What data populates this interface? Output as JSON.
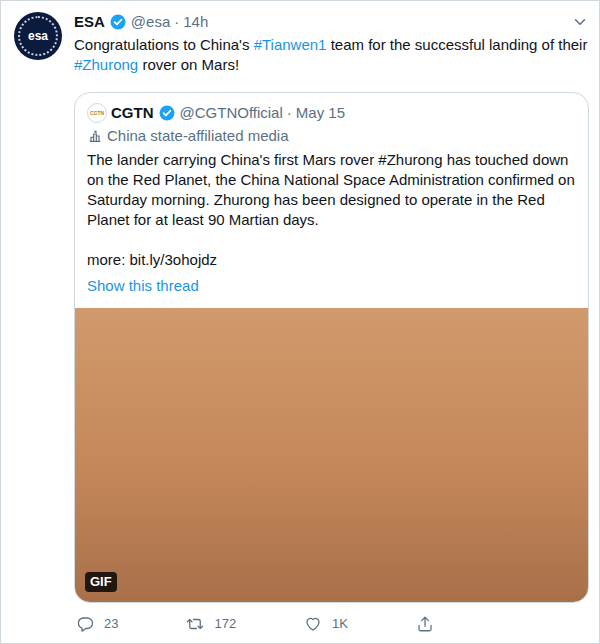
{
  "tweet": {
    "author_name": "ESA",
    "logo_text": "esa",
    "verified": true,
    "handle": "@esa",
    "separator": "·",
    "time": "14h",
    "text": [
      {
        "text": "Congratulations to China's ",
        "kind": "plain"
      },
      {
        "text": "#Tianwen1",
        "kind": "hashtag"
      },
      {
        "text": " team for the successful landing of their ",
        "kind": "plain"
      },
      {
        "text": "#Zhurong",
        "kind": "hashtag"
      },
      {
        "text": " rover on Mars!",
        "kind": "plain"
      }
    ]
  },
  "quoted": {
    "author_name": "CGTN",
    "logo_text": "CGTN",
    "verified": true,
    "handle": "@CGTNOfficial",
    "separator": "·",
    "time": "May 15",
    "label": "China state-affiliated media",
    "text": "The lander carrying China's first Mars rover #Zhurong has touched down on the Red Planet, the China National Space Administration confirmed on Saturday morning. Zhurong has been designed to operate in the Red Planet for at least 90 Martian days.",
    "link_line": "more: bit.ly/3ohojdz",
    "thread_link": "Show this thread",
    "media_badge": "GIF"
  },
  "actions": [
    {
      "kind": "reply",
      "count": "23"
    },
    {
      "kind": "retweet",
      "count": "172"
    },
    {
      "kind": "like",
      "count": "1K"
    },
    {
      "kind": "share"
    }
  ]
}
